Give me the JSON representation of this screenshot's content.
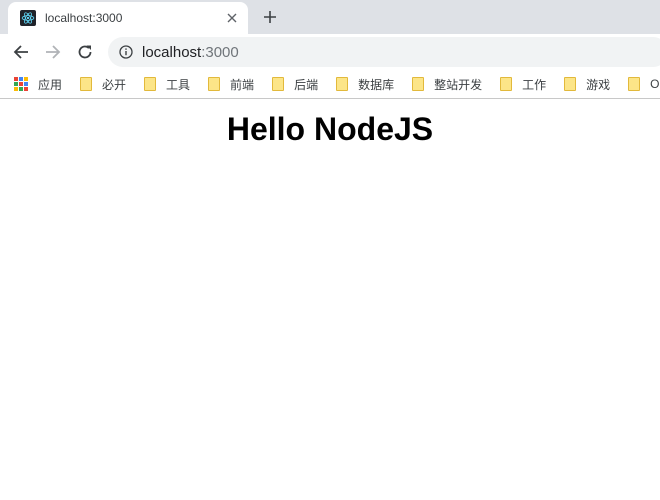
{
  "tab": {
    "title": "localhost:3000",
    "close_glyph": "✕",
    "favicon": "react-icon"
  },
  "toolbar": {
    "url_host": "localhost",
    "url_port": ":3000"
  },
  "bookmarks": {
    "apps_label": "应用",
    "items": [
      {
        "label": "必开"
      },
      {
        "label": "工具"
      },
      {
        "label": "前端"
      },
      {
        "label": "后端"
      },
      {
        "label": "数据库"
      },
      {
        "label": "整站开发"
      },
      {
        "label": "工作"
      },
      {
        "label": "游戏"
      },
      {
        "label": "O"
      }
    ]
  },
  "page": {
    "heading": "Hello NodeJS"
  },
  "colors": {
    "tab_strip": "#dee1e6",
    "omnibox": "#f1f3f4",
    "folder": "#fce588",
    "favicon_bg": "#20232a",
    "react_blue": "#61dafb"
  }
}
